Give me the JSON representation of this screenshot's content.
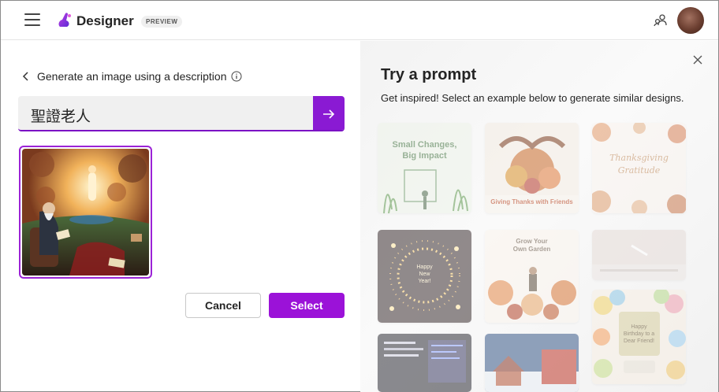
{
  "header": {
    "brand": "Designer",
    "badge": "PREVIEW"
  },
  "left": {
    "back_label": "Generate an image using a description",
    "prompt_value": "聖證老人",
    "cancel_label": "Cancel",
    "select_label": "Select"
  },
  "right": {
    "title": "Try a prompt",
    "subtitle": "Get inspired! Select an example below to generate similar designs.",
    "cards": [
      {
        "line1": "Small Changes,",
        "line2": "Big Impact"
      },
      {
        "line1": "Giving Thanks with Friends"
      },
      {
        "line1": "Thanksgiving",
        "line2": "Gratitude"
      },
      {
        "line1": "Happy",
        "line2": "New",
        "line3": "Year!"
      },
      {
        "line1": "Grow Your",
        "line2": "Own Garden"
      },
      {
        "line1": ""
      },
      {
        "line1": ""
      },
      {
        "line1": ""
      },
      {
        "line1": "Happy",
        "line2": "Birthday to a",
        "line3": "Dear Friend!"
      }
    ]
  },
  "colors": {
    "accent": "#9b12d8",
    "accent_dark": "#8a1ad3"
  }
}
